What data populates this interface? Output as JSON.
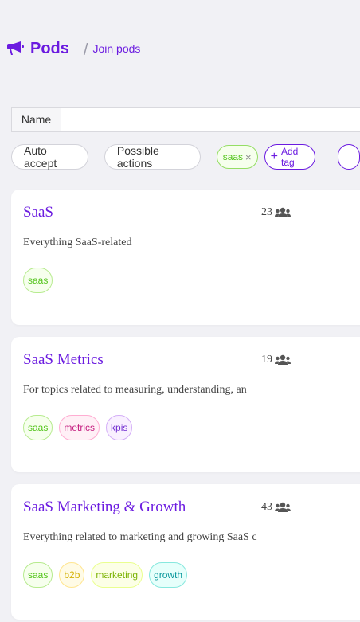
{
  "header": {
    "icon": "megaphone-icon",
    "title": "Pods",
    "separator": "/",
    "breadcrumb": "Join pods"
  },
  "search": {
    "label": "Name",
    "value": "",
    "placeholder": ""
  },
  "filters": {
    "auto_accept": "Auto accept",
    "possible_actions": "Possible actions",
    "selected_tag": "saas",
    "remove_icon": "×",
    "add_tag": "Add tag",
    "add_icon": "+"
  },
  "pods": [
    {
      "name": "SaaS",
      "members": "23",
      "description": "Everything SaaS-related",
      "tags": [
        "saas"
      ]
    },
    {
      "name": "SaaS Metrics",
      "members": "19",
      "description": "For topics related to measuring, understanding, an",
      "tags": [
        "saas",
        "metrics",
        "kpis"
      ]
    },
    {
      "name": "SaaS Marketing & Growth",
      "members": "43",
      "description": "Everything related to marketing and growing SaaS c",
      "tags": [
        "saas",
        "b2b",
        "marketing",
        "growth"
      ]
    }
  ],
  "colors": {
    "accent": "#6b1be0",
    "background": "#f1f1f5"
  }
}
